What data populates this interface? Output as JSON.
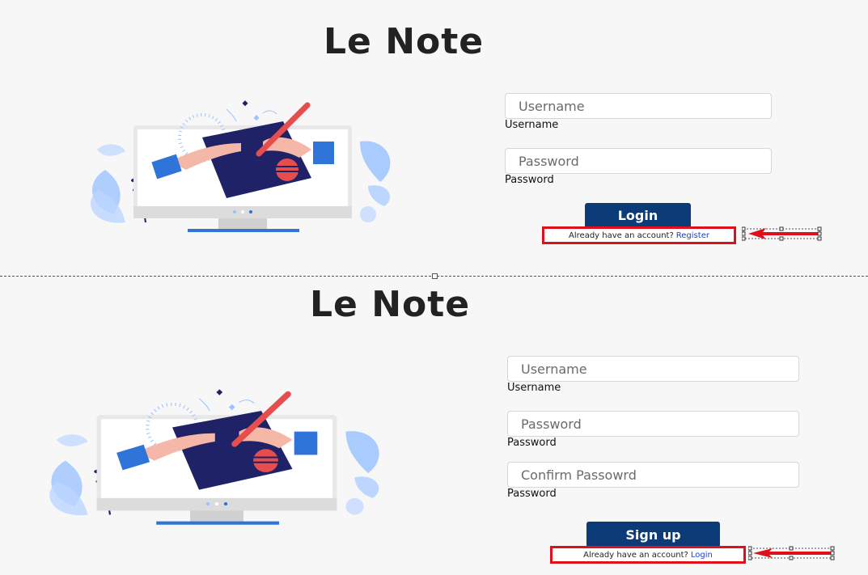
{
  "login": {
    "title": "Le Note",
    "username_placeholder": "Username",
    "username_label": "Username",
    "password_placeholder": "Password",
    "password_label": "Password",
    "button_label": "Login",
    "hint_text": "Already have an account?",
    "hint_link": "Register"
  },
  "signup": {
    "title": "Le Note",
    "username_placeholder": "Username",
    "username_label": "Username",
    "password_placeholder": "Password",
    "password_label": "Password",
    "confirm_placeholder": "Confirm Passowrd",
    "confirm_label": "Password",
    "button_label": "Sign up",
    "hint_text": "Already have an account?",
    "hint_link": "Login"
  },
  "colors": {
    "background": "#f7f7f7",
    "button": "#0b3c78",
    "highlight_box": "#e0101a",
    "link": "#1d3fcf",
    "illustration_navy": "#1f2266",
    "illustration_blue": "#2f74d8",
    "illustration_light_blue": "#9cc3ff",
    "illustration_red": "#e84d4d",
    "illustration_skin": "#f5b8a8"
  },
  "icons": [
    "computer-illustration",
    "pen-icon",
    "arrow-annotation"
  ]
}
